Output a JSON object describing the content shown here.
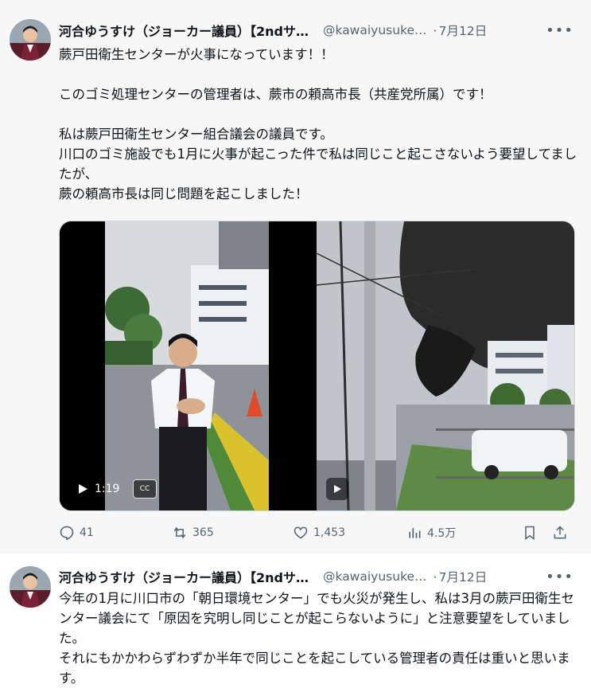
{
  "tweets": [
    {
      "name": "河合ゆうすけ（ジョーカー議員）【2ndサ…",
      "handle": "@kawaiyusuke…",
      "date": "7月12日",
      "text": "蕨戸田衛生センターが火事になっています！！\n\nこのゴミ処理センターの管理者は、蕨市の頼高市長（共産党所属）です！\n\n私は蕨戸田衛生センター組合議会の議員です。\n川口のゴミ施設でも1月に火事が起こった件で私は同じこと起こさないよう要望してましたが、\n蕨の頼高市長は同じ問題を起こしました！",
      "video_duration": "1:19",
      "cc_label": "CC",
      "metrics": {
        "replies": "41",
        "reposts": "365",
        "likes": "1,453",
        "views": "4.5万"
      }
    },
    {
      "name": "河合ゆうすけ（ジョーカー議員）【2ndサ…",
      "handle": "@kawaiyusuke…",
      "date": "7月12日",
      "text": "今年の1月に川口市の「朝日環境センター」でも火災が発生し、私は3月の蕨戸田衛生センター議会にて「原因を究明し同じことが起こらないように」と注意要望をしていました。\nそれにもかかわらずわずか半年で同じことを起こしている管理者の責任は重いと思います。"
    }
  ],
  "ui": {
    "dot": "·",
    "more": "•••"
  },
  "colors": {
    "text": "#0f1419",
    "secondary": "#536471",
    "thread_line": "#cfd9de",
    "fire_smoke": "#2b2b2b"
  }
}
